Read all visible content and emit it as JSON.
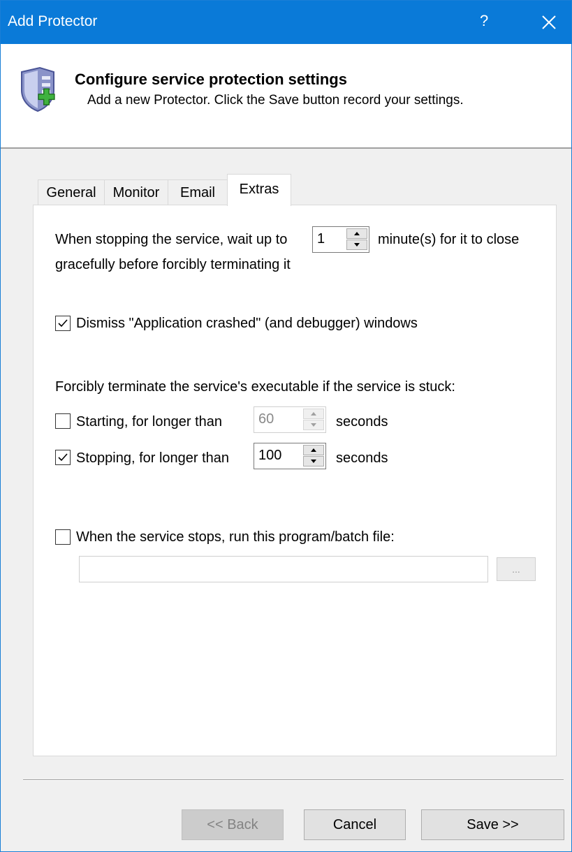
{
  "window": {
    "title": "Add Protector",
    "help_label": "?",
    "close_icon": "close-icon"
  },
  "header": {
    "title": "Configure service protection settings",
    "subtitle": "Add a new Protector. Click the Save button record your settings.",
    "icon": "shield-add-icon"
  },
  "tabs": [
    {
      "label": "General",
      "active": false
    },
    {
      "label": "Monitor",
      "active": false
    },
    {
      "label": "Email",
      "active": false
    },
    {
      "label": "Extras",
      "active": true
    }
  ],
  "extras": {
    "stop_wait": {
      "prefix": "When stopping the service, wait up to",
      "value": "1",
      "suffix": "minute(s) for it to close",
      "line2": "gracefully before forcibly terminating it"
    },
    "dismiss_crashed": {
      "label": "Dismiss \"Application crashed\" (and debugger) windows",
      "checked": true
    },
    "terminate_heading": "Forcibly terminate the service's executable if the service is stuck:",
    "starting": {
      "label": "Starting, for longer than",
      "checked": false,
      "value": "60",
      "unit": "seconds",
      "enabled": false
    },
    "stopping": {
      "label": "Stopping, for longer than",
      "checked": true,
      "value": "100",
      "unit": "seconds",
      "enabled": true
    },
    "run_program": {
      "label": "When the service stops, run this program/batch file:",
      "checked": false,
      "path_value": "",
      "browse_label": "..."
    }
  },
  "buttons": {
    "back": "<< Back",
    "cancel": "Cancel",
    "save": "Save >>"
  },
  "colors": {
    "titlebar": "#0a7ad8",
    "dialog_bg": "#f0f0f0"
  }
}
